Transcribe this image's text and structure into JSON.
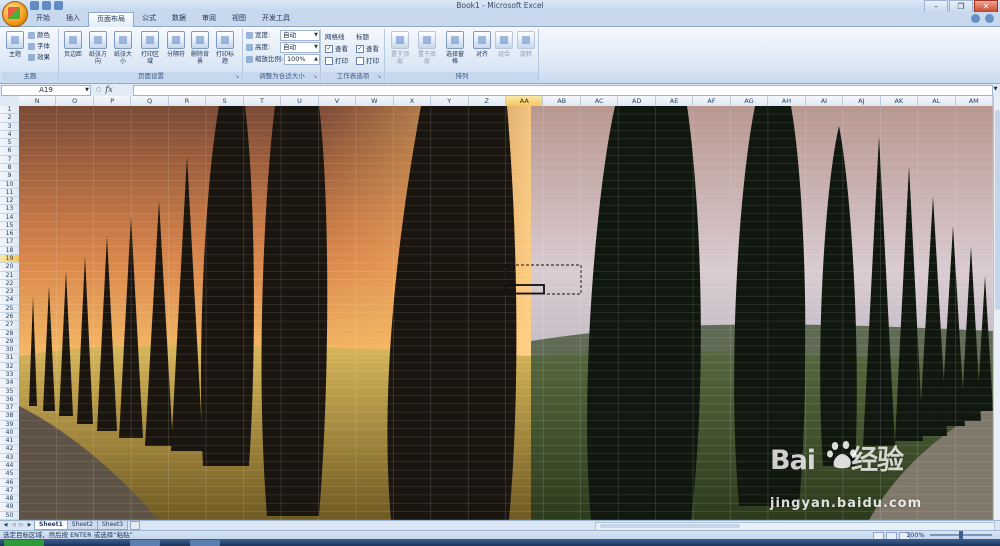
{
  "window": {
    "title": "Book1 - Microsoft Excel",
    "controls": [
      "–",
      "❐",
      "✕"
    ]
  },
  "ribbon_tabs": [
    "开始",
    "插入",
    "页面布局",
    "公式",
    "数据",
    "审阅",
    "视图",
    "开发工具"
  ],
  "active_tab": "页面布局",
  "ribbon": {
    "themes": {
      "label": "主题",
      "button": "主题",
      "colors": "颜色",
      "fonts": "字体",
      "effects": "效果"
    },
    "page_setup": {
      "label": "页面设置",
      "buttons": [
        "页边距",
        "纸张方向",
        "纸张大小",
        "打印区域",
        "分隔符",
        "删除背景",
        "打印标题"
      ]
    },
    "scale": {
      "label": "调整为合适大小",
      "width_label": "宽度:",
      "width_value": "自动",
      "height_label": "高度:",
      "height_value": "自动",
      "scale_label": "缩放比例:",
      "scale_value": "100%"
    },
    "sheet_options": {
      "label": "工作表选项",
      "gridlines": "网格线",
      "headings": "标题",
      "view": "查看",
      "print": "打印"
    },
    "arrange": {
      "label": "排列",
      "buttons": [
        "置于顶层",
        "置于底层",
        "选择窗格",
        "对齐",
        "组合",
        "旋转"
      ]
    }
  },
  "formula_bar": {
    "name_box": "A19",
    "fx": "fx",
    "formula": ""
  },
  "grid": {
    "columns": [
      "N",
      "O",
      "P",
      "Q",
      "R",
      "S",
      "T",
      "U",
      "V",
      "W",
      "X",
      "Y",
      "Z",
      "AA",
      "AB",
      "AC",
      "AD",
      "AE",
      "AF",
      "AG",
      "AH",
      "AI",
      "AJ",
      "AK",
      "AL",
      "AM"
    ],
    "selected_column": "AA",
    "row_count": 50,
    "selected_row": 19
  },
  "sheet_tabs": [
    "Sheet1",
    "Sheet2",
    "Sheet3"
  ],
  "active_sheet": "Sheet1",
  "status": {
    "text": "选定目标区域，然后按 ENTER 或选择“粘贴”",
    "zoom": "100%"
  },
  "watermark": {
    "brand_left": "Bai",
    "brand_right": "经验",
    "url": "jingyan.baidu.com"
  },
  "colors": {
    "accent": "#f6c65b",
    "ribbon": "#dbe7f5",
    "sky_top": "#8b5a3f",
    "sky_glow": "#f6b15a"
  }
}
